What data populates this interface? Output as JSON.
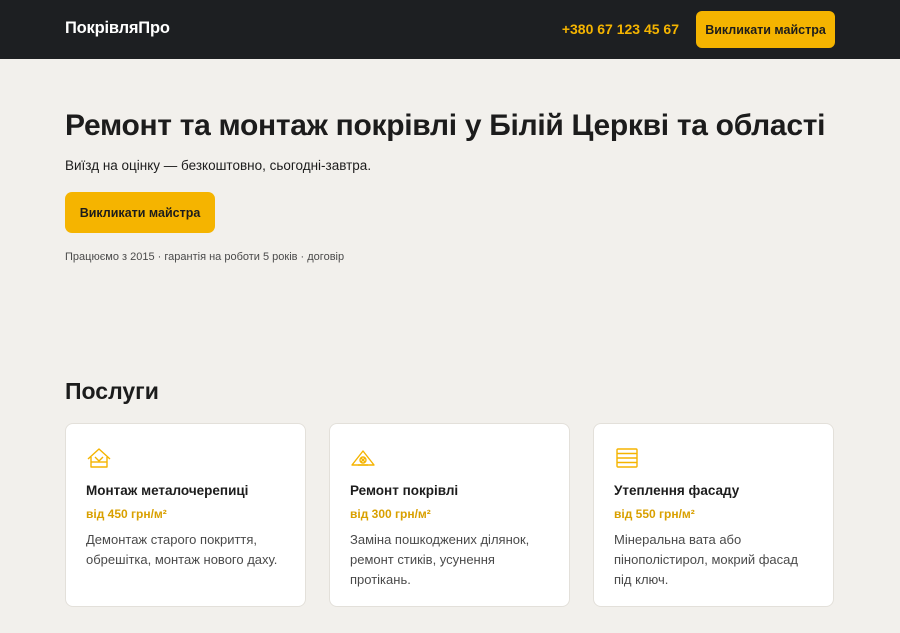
{
  "header": {
    "brand": "ПокрівляПро",
    "phone": "+380 67 123 45 67",
    "cta_label": "Викликати майстра"
  },
  "hero": {
    "title": "Ремонт та монтаж покрівлі у Білій Церкві та області",
    "subtitle": "Виїзд на оцінку — безкоштовно, сьогодні-завтра.",
    "cta_label": "Викликати майстра",
    "trust": "Працюємо з 2015 · гарантія на роботи 5 років · договір"
  },
  "services": {
    "title": "Послуги",
    "items": [
      {
        "icon": "roof-tile-icon",
        "title": "Монтаж металочерепиці",
        "price": "від 450 грн/м²",
        "description": "Демонтаж старого покриття, обрешітка, монтаж нового даху."
      },
      {
        "icon": "roof-repair-icon",
        "title": "Ремонт покрівлі",
        "price": "від 300 грн/м²",
        "description": "Заміна пошкоджених ділянок, ремонт стиків, усунення протікань."
      },
      {
        "icon": "facade-insulation-icon",
        "title": "Утеплення фасаду",
        "price": "від 550 грн/м²",
        "description": "Мінеральна вата або пінополістирол, мокрий фасад під ключ."
      }
    ]
  },
  "colors": {
    "header_bg": "#1d1f22",
    "accent": "#f5b400",
    "page_bg": "#f2f0ec"
  }
}
